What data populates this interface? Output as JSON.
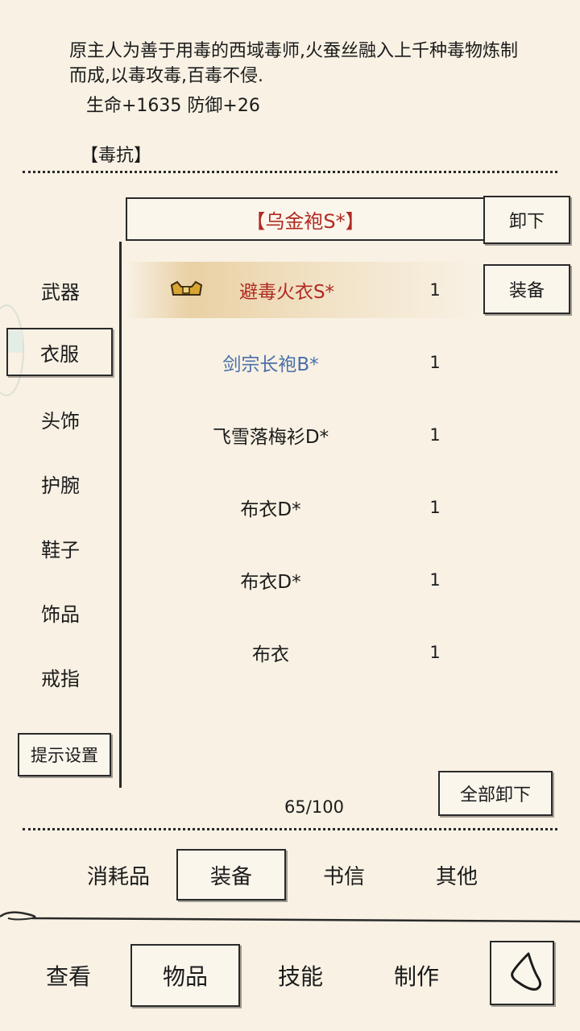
{
  "item_detail": {
    "description": "原主人为善于用毒的西域毒师,火蚕丝融入上千种毒物炼制而成,以毒攻毒,百毒不侵.",
    "stats": "生命+1635 防御+26",
    "trait": "【毒抗】"
  },
  "equipped": {
    "name": "【乌金袍S*】",
    "unequip_label": "卸下"
  },
  "equip_label": "装备",
  "categories": [
    "武器",
    "衣服",
    "头饰",
    "护腕",
    "鞋子",
    "饰品",
    "戒指"
  ],
  "selected_category": "衣服",
  "hint_settings_label": "提示设置",
  "items": [
    {
      "name": "避毒火衣S*",
      "qty": "1",
      "color": "#b02a22"
    },
    {
      "name": "剑宗长袍B*",
      "qty": "1",
      "color": "#4a6fa8"
    },
    {
      "name": "飞雪落梅衫D*",
      "qty": "1",
      "color": "#1b1b1b"
    },
    {
      "name": "布衣D*",
      "qty": "1",
      "color": "#1b1b1b"
    },
    {
      "name": "布衣D*",
      "qty": "1",
      "color": "#1b1b1b"
    },
    {
      "name": "布衣",
      "qty": "1",
      "color": "#1b1b1b"
    }
  ],
  "unequip_all_label": "全部卸下",
  "capacity": "65/100",
  "item_tabs": [
    "消耗品",
    "装备",
    "书信",
    "其他"
  ],
  "selected_item_tab": "装备",
  "nav_tabs": [
    "查看",
    "物品",
    "技能",
    "制作"
  ],
  "selected_nav_tab": "物品"
}
